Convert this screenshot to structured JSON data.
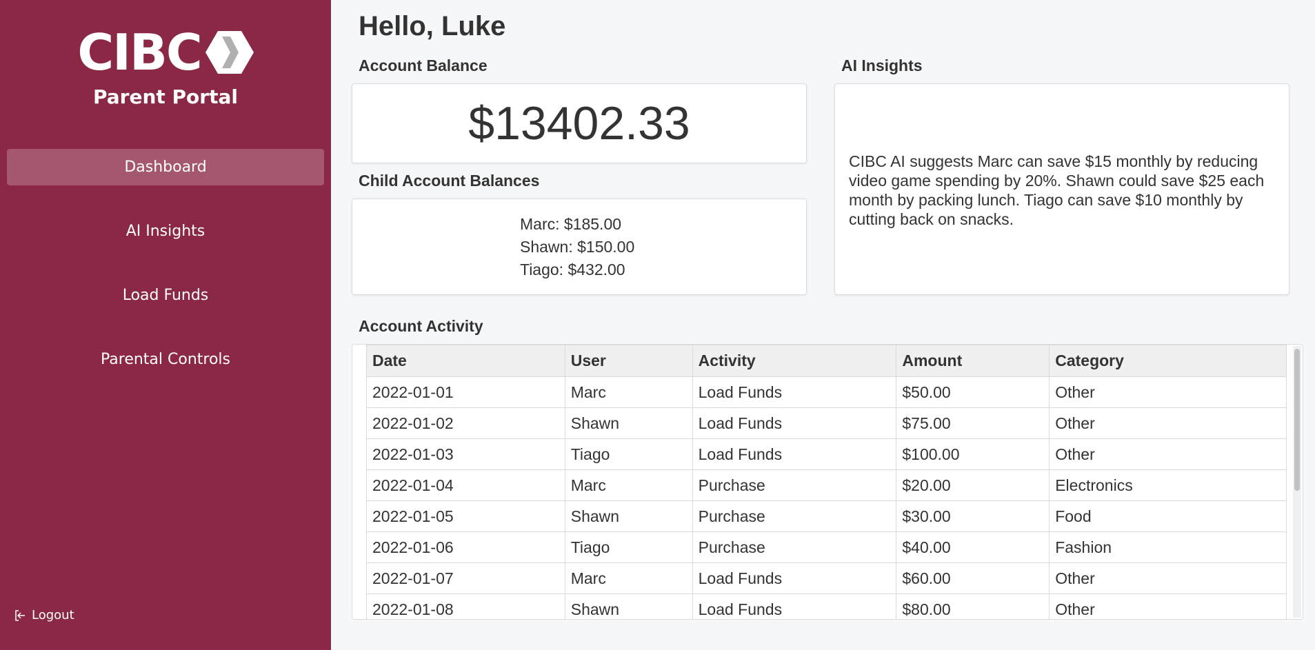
{
  "brand": {
    "logo_text": "CIBC",
    "portal_title": "Parent Portal",
    "primary_color": "#8b2845"
  },
  "nav": {
    "items": [
      {
        "label": "Dashboard",
        "active": true
      },
      {
        "label": "AI Insights",
        "active": false
      },
      {
        "label": "Load Funds",
        "active": false
      },
      {
        "label": "Parental Controls",
        "active": false
      }
    ],
    "logout_label": "Logout",
    "logout_icon": "logout-icon"
  },
  "greeting": "Hello, Luke",
  "account_balance": {
    "label": "Account Balance",
    "value": "$13402.33"
  },
  "child_balances": {
    "label": "Child Account Balances",
    "items": [
      "Marc: $185.00",
      "Shawn: $150.00",
      "Tiago: $432.00"
    ]
  },
  "ai_insights": {
    "label": "AI Insights",
    "text": "CIBC AI suggests Marc can save $15 monthly by reducing video game spending by 20%. Shawn could save $25 each month by packing lunch. Tiago can save $10 monthly by cutting back on snacks."
  },
  "activity": {
    "label": "Account Activity",
    "columns": [
      "Date",
      "User",
      "Activity",
      "Amount",
      "Category"
    ],
    "rows": [
      [
        "2022-01-01",
        "Marc",
        "Load Funds",
        "$50.00",
        "Other"
      ],
      [
        "2022-01-02",
        "Shawn",
        "Load Funds",
        "$75.00",
        "Other"
      ],
      [
        "2022-01-03",
        "Tiago",
        "Load Funds",
        "$100.00",
        "Other"
      ],
      [
        "2022-01-04",
        "Marc",
        "Purchase",
        "$20.00",
        "Electronics"
      ],
      [
        "2022-01-05",
        "Shawn",
        "Purchase",
        "$30.00",
        "Food"
      ],
      [
        "2022-01-06",
        "Tiago",
        "Purchase",
        "$40.00",
        "Fashion"
      ],
      [
        "2022-01-07",
        "Marc",
        "Load Funds",
        "$60.00",
        "Other"
      ],
      [
        "2022-01-08",
        "Shawn",
        "Load Funds",
        "$80.00",
        "Other"
      ]
    ]
  }
}
